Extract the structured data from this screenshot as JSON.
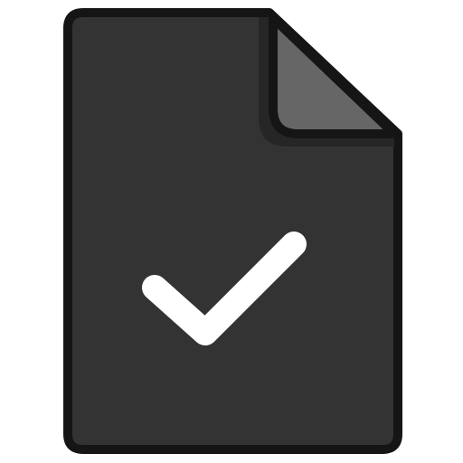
{
  "icon": {
    "name": "file-check-icon",
    "colors": {
      "background": "#ffffff",
      "outline": "#151515",
      "body": "#333333",
      "fold_shadow": "#262626",
      "fold": "#666666",
      "check": "#ffffff"
    }
  }
}
